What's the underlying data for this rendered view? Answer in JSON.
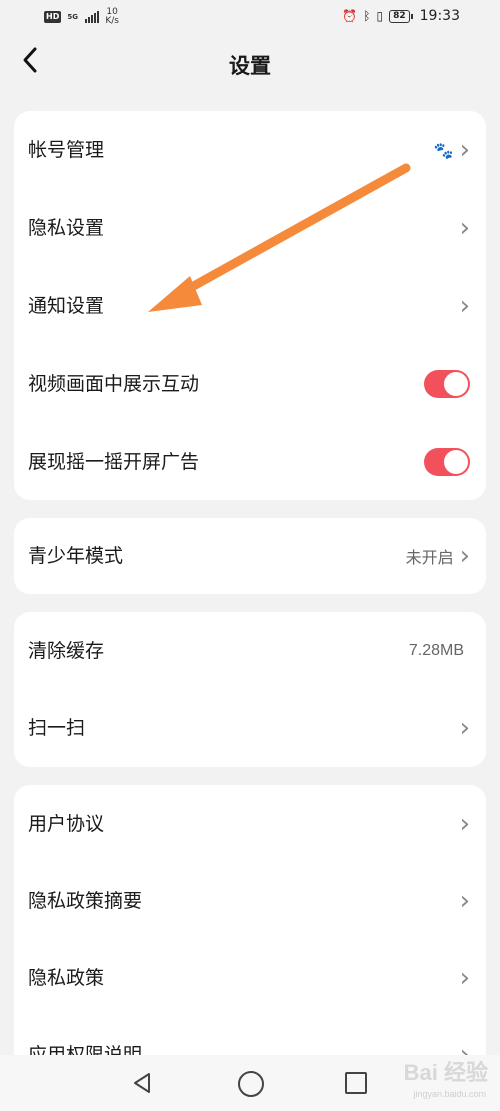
{
  "status_bar": {
    "hd": "HD",
    "signal_label": "5G",
    "net_speed_value": "10",
    "net_speed_unit": "K/s",
    "battery": "82",
    "time": "19:33"
  },
  "header": {
    "title": "设置"
  },
  "card1": {
    "items": [
      {
        "label": "帐号管理"
      },
      {
        "label": "隐私设置"
      },
      {
        "label": "通知设置"
      },
      {
        "label": "视频画面中展示互动",
        "toggle": true
      },
      {
        "label": "展现摇一摇开屏广告",
        "toggle": true
      }
    ]
  },
  "card2": {
    "items": [
      {
        "label": "青少年模式",
        "value": "未开启"
      }
    ]
  },
  "card3": {
    "items": [
      {
        "label": "清除缓存",
        "value": "7.28MB"
      },
      {
        "label": "扫一扫"
      }
    ]
  },
  "card4": {
    "items": [
      {
        "label": "用户协议"
      },
      {
        "label": "隐私政策摘要"
      },
      {
        "label": "隐私政策"
      },
      {
        "label": "应用权限说明"
      }
    ]
  },
  "watermark": {
    "brand": "Bai 经验",
    "domain": "jingyan.baidu.com"
  },
  "colors": {
    "accent": "#f2505a",
    "arrow": "#f58a3a"
  }
}
